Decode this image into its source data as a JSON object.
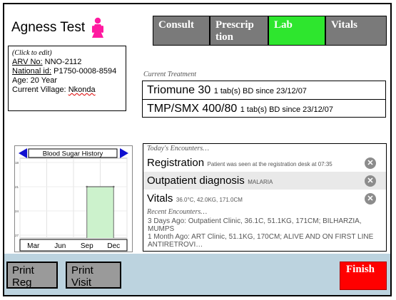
{
  "patient": {
    "name": "Agness Test",
    "click_to_edit": "(Click to edit)",
    "arv_label": "ARV No:",
    "arv_value": "NNO-2112",
    "national_label": "National id:",
    "national_value": "P1750-0008-8594",
    "age": "Age: 20 Year",
    "village_label": "Current Village:",
    "village_value": "Nkonda",
    "gender_icon": "female-icon"
  },
  "tabs": [
    {
      "label": "Consult",
      "active": false
    },
    {
      "label": "Prescrip tion",
      "active": false
    },
    {
      "label": "Lab",
      "active": true
    },
    {
      "label": "Vitals",
      "active": false
    }
  ],
  "treatment": {
    "label": "Current Treatment",
    "items": [
      {
        "name": "Triomune 30",
        "dose": "1 tab(s) BD since 23/12/07"
      },
      {
        "name": "TMP/SMX 400/80",
        "dose": "1 tab(s) BD since 23/12/07"
      }
    ]
  },
  "chart_data": {
    "type": "line",
    "title": "Blood Sugar History",
    "categories": [
      "Mar",
      "Jun",
      "Sep",
      "Dec"
    ],
    "ytick_labels": [
      "18",
      "21",
      "24",
      "27"
    ],
    "series": [
      {
        "values": [
          null,
          null,
          21,
          21
        ]
      }
    ],
    "fill_color": "#ccf2cc",
    "line_color": "#6a6a6a",
    "nav_color": "#1010d0"
  },
  "encounters": {
    "today_label": "Today's Encounters…",
    "today": [
      {
        "title": "Registration",
        "desc": "Patient was seen at the registration desk at 07:35",
        "shaded": false
      },
      {
        "title": "Outpatient diagnosis",
        "desc": "MALARIA",
        "shaded": true
      },
      {
        "title": "Vitals",
        "desc": "36.0°C, 42.0KG, 171.0CM",
        "shaded": false
      }
    ],
    "delete_glyph": "✕",
    "recent_label": "Recent Encounters…",
    "recent": [
      "3 Days Ago: Outpatient Clinic, 36.1C, 51.1KG, 171CM; BILHARZIA, MUMPS",
      "1 Month Ago: ART Clinic, 51.1KG, 170CM; ALIVE AND ON FIRST LINE ANTIRETROVI…"
    ]
  },
  "footer": {
    "print_reg": "Print Reg",
    "print_visit": "Print Visit",
    "finish": "Finish"
  }
}
